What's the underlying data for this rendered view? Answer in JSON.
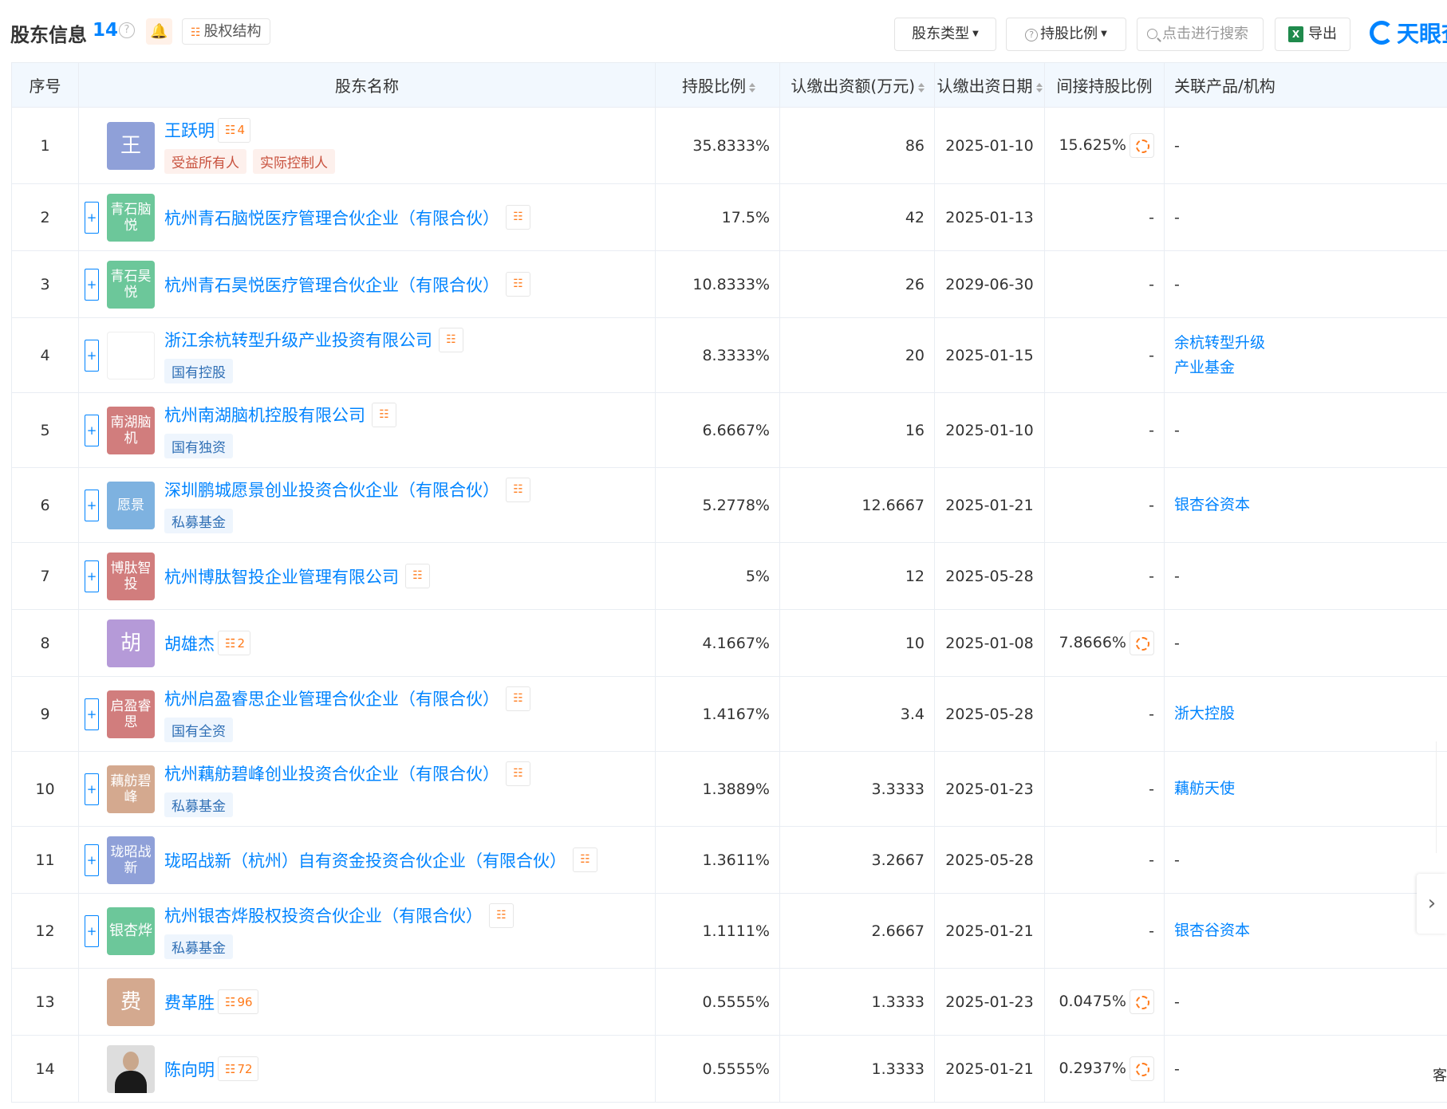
{
  "header": {
    "title": "股东信息",
    "count": "14",
    "help": "?",
    "structure_label": "股权结构",
    "filter_type": "股东类型",
    "filter_ratio": "持股比例",
    "search_placeholder": "点击进行搜索",
    "export_label": "导出",
    "brand": "天眼查"
  },
  "table": {
    "columns": {
      "index": "序号",
      "name": "股东名称",
      "ratio": "持股比例",
      "amount": "认缴出资额(万元)",
      "date": "认缴出资日期",
      "indirect": "间接持股比例",
      "related": "关联产品/机构"
    },
    "rows": [
      {
        "index": "1",
        "avatar": "王",
        "avatar_color": "#8fa0d8",
        "name": "王跃明",
        "person": true,
        "rel_count": "4",
        "tags": [
          "受益所有人",
          "实际控制人"
        ],
        "tag_style": "red",
        "ratio": "35.8333%",
        "amount": "86",
        "date": "2025-01-10",
        "indirect": "15.625%",
        "related": [
          "-"
        ]
      },
      {
        "index": "2",
        "avatar": "青石脑悦",
        "avatar_color": "#6cc79a",
        "name": "杭州青石脑悦医疗管理合伙企业（有限合伙）",
        "tags": [],
        "ratio": "17.5%",
        "amount": "42",
        "date": "2025-01-13",
        "indirect": "-",
        "related": [
          "-"
        ]
      },
      {
        "index": "3",
        "avatar": "青石昊悦",
        "avatar_color": "#6cc79a",
        "name": "杭州青石昊悦医疗管理合伙企业（有限合伙）",
        "tags": [],
        "ratio": "10.8333%",
        "amount": "26",
        "date": "2029-06-30",
        "indirect": "-",
        "related": [
          "-"
        ]
      },
      {
        "index": "4",
        "avatar": "",
        "avatar_color": "#ffffff",
        "name": "浙江余杭转型升级产业投资有限公司",
        "tags": [
          "国有控股"
        ],
        "tag_style": "blue",
        "ratio": "8.3333%",
        "amount": "20",
        "date": "2025-01-15",
        "indirect": "-",
        "related": [
          "余杭转型升级",
          "产业基金"
        ]
      },
      {
        "index": "5",
        "avatar": "南湖脑机",
        "avatar_color": "#d17d7d",
        "name": "杭州南湖脑机控股有限公司",
        "tags": [
          "国有独资"
        ],
        "tag_style": "blue",
        "ratio": "6.6667%",
        "amount": "16",
        "date": "2025-01-10",
        "indirect": "-",
        "related": [
          "-"
        ]
      },
      {
        "index": "6",
        "avatar": "愿景",
        "avatar_color": "#7eb2e0",
        "name": "深圳鹏城愿景创业投资合伙企业（有限合伙）",
        "tags": [
          "私募基金"
        ],
        "tag_style": "blue",
        "ratio": "5.2778%",
        "amount": "12.6667",
        "date": "2025-01-21",
        "indirect": "-",
        "related": [
          "银杏谷资本"
        ]
      },
      {
        "index": "7",
        "avatar": "博肽智投",
        "avatar_color": "#d17d7d",
        "name": "杭州博肽智投企业管理有限公司",
        "tags": [],
        "ratio": "5%",
        "amount": "12",
        "date": "2025-05-28",
        "indirect": "-",
        "related": [
          "-"
        ]
      },
      {
        "index": "8",
        "avatar": "胡",
        "avatar_color": "#b59ad8",
        "name": "胡雄杰",
        "person": true,
        "rel_count": "2",
        "tags": [],
        "ratio": "4.1667%",
        "amount": "10",
        "date": "2025-01-08",
        "indirect": "7.8666%",
        "related": [
          "-"
        ]
      },
      {
        "index": "9",
        "avatar": "启盈睿思",
        "avatar_color": "#d17d7d",
        "name": "杭州启盈睿思企业管理合伙企业（有限合伙）",
        "tags": [
          "国有全资"
        ],
        "tag_style": "blue",
        "ratio": "1.4167%",
        "amount": "3.4",
        "date": "2025-05-28",
        "indirect": "-",
        "related": [
          "浙大控股"
        ]
      },
      {
        "index": "10",
        "avatar": "藕舫碧峰",
        "avatar_color": "#d4a98f",
        "name": "杭州藕舫碧峰创业投资合伙企业（有限合伙）",
        "tags": [
          "私募基金"
        ],
        "tag_style": "blue",
        "ratio": "1.3889%",
        "amount": "3.3333",
        "date": "2025-01-23",
        "indirect": "-",
        "related": [
          "藕舫天使"
        ]
      },
      {
        "index": "11",
        "avatar": "珑昭战新",
        "avatar_color": "#8fa0d8",
        "name": "珑昭战新（杭州）自有资金投资合伙企业（有限合伙）",
        "tags": [],
        "ratio": "1.3611%",
        "amount": "3.2667",
        "date": "2025-05-28",
        "indirect": "-",
        "related": [
          "-"
        ]
      },
      {
        "index": "12",
        "avatar": "银杏烨",
        "avatar_color": "#6cc79a",
        "name": "杭州银杏烨股权投资合伙企业（有限合伙）",
        "tags": [
          "私募基金"
        ],
        "tag_style": "blue",
        "ratio": "1.1111%",
        "amount": "2.6667",
        "date": "2025-01-21",
        "indirect": "-",
        "related": [
          "银杏谷资本"
        ]
      },
      {
        "index": "13",
        "avatar": "费",
        "avatar_color": "#d4a98f",
        "name": "费革胜",
        "person": true,
        "rel_count": "96",
        "tags": [],
        "ratio": "0.5555%",
        "amount": "1.3333",
        "date": "2025-01-23",
        "indirect": "0.0475%",
        "related": [
          "-"
        ]
      },
      {
        "index": "14",
        "avatar": "",
        "avatar_color": "#dddddd",
        "name": "陈向明",
        "person": true,
        "rel_count": "72",
        "tags": [],
        "ratio": "0.5555%",
        "amount": "1.3333",
        "date": "2025-01-21",
        "indirect": "0.2937%",
        "related": [
          "-"
        ]
      }
    ]
  },
  "side": {
    "chat_label": "客"
  }
}
